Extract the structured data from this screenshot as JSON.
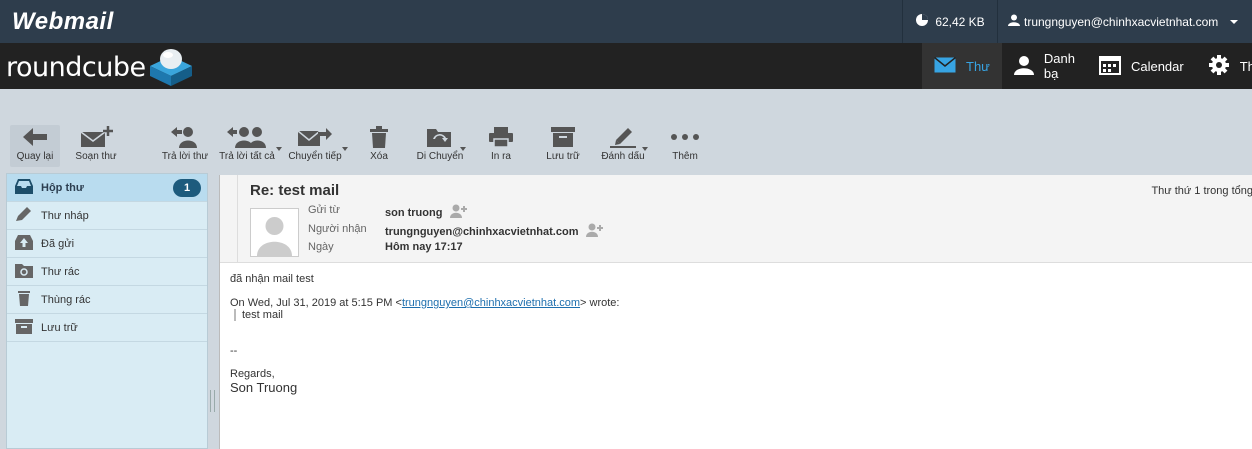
{
  "topbar": {
    "app_title": "Webmail",
    "quota": "62,42 KB",
    "user_email": "trungnguyen@chinhxacvietnhat.com"
  },
  "header": {
    "logo_text": "roundcube",
    "nav": [
      {
        "label": "Thư",
        "icon": "mail-icon",
        "active": true
      },
      {
        "label": "Danh bạ",
        "icon": "contacts-icon"
      },
      {
        "label": "Calendar",
        "icon": "calendar-icon"
      },
      {
        "label": "Th",
        "icon": "gear-icon"
      }
    ]
  },
  "toolbar": {
    "back": "Quay lại",
    "compose": "Soạn thư",
    "reply": "Trả lời thư",
    "reply_all": "Trả lời tất cả",
    "forward": "Chuyển tiếp",
    "delete": "Xóa",
    "move": "Di Chuyển",
    "print": "In ra",
    "archive": "Lưu trữ",
    "mark": "Đánh dấu",
    "more": "Thêm"
  },
  "folders": [
    {
      "label": "Hộp thư",
      "icon": "inbox-icon",
      "count": "1",
      "selected": true
    },
    {
      "label": "Thư nháp",
      "icon": "pencil-icon"
    },
    {
      "label": "Đã gửi",
      "icon": "sent-icon"
    },
    {
      "label": "Thư rác",
      "icon": "junk-icon"
    },
    {
      "label": "Thùng rác",
      "icon": "trash-icon"
    },
    {
      "label": "Lưu trữ",
      "icon": "archive-icon"
    }
  ],
  "message": {
    "subject": "Re: test mail",
    "count_text": "Thư thứ 1 trong tổng",
    "from_label": "Gửi từ",
    "from_value": "son truong",
    "to_label": "Người nhận",
    "to_value": "trungnguyen@chinhxacvietnhat.com",
    "date_label": "Ngày",
    "date_value": "Hôm nay 17:17",
    "body_line1": "đã nhận mail test",
    "quote_intro_prefix": "On Wed, Jul 31, 2019 at 5:15 PM <",
    "quote_link": "trungnguyen@chinhxacvietnhat.com",
    "quote_intro_suffix": "> wrote:",
    "quote_text": "test mail",
    "sig_sep": "--",
    "sig_regards": "Regards,",
    "sig_name": "Son Truong"
  },
  "colors": {
    "topbar": "#2e3d4c",
    "header": "#222222",
    "accent": "#37a4e3",
    "badge": "#1d5b7d"
  }
}
